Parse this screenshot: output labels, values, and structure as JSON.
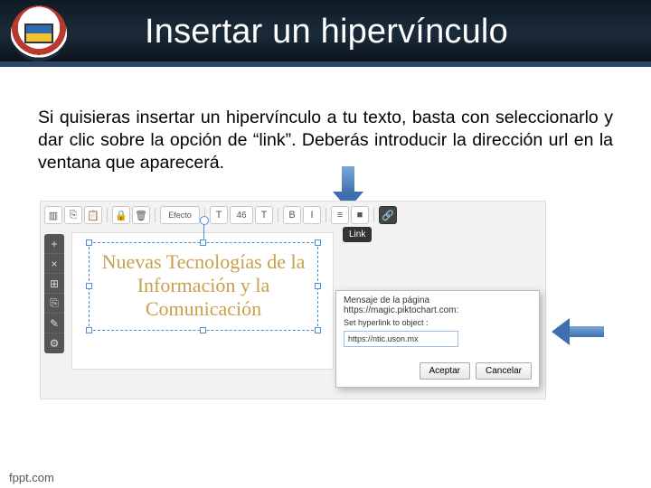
{
  "header": {
    "title": "Insertar un hipervínculo"
  },
  "body": {
    "paragraph": "Si quisieras insertar un hipervínculo a tu texto, basta con seleccionarlo y dar clic sobre la opción de “link”. Deberás introducir la dirección url en la ventana que aparecerá."
  },
  "toolbar": {
    "items": [
      "content",
      "copy",
      "paste",
      "separator",
      "lock",
      "delete",
      "separator",
      "effects",
      "separator",
      "font-size",
      "font-dec",
      "font-inc",
      "separator",
      "bold",
      "italic",
      "separator",
      "align",
      "color",
      "separator",
      "link"
    ],
    "link_tooltip": "Link",
    "effects_label": "Efecto",
    "font_size_value": "46"
  },
  "sidetool": {
    "items": [
      "+",
      "×",
      "⊞",
      "⎘",
      "✎",
      "⚙"
    ]
  },
  "canvas": {
    "selected_text": "Nuevas Tecnologías de la Información y la Comunicación"
  },
  "dialog": {
    "title": "Mensaje de la página https://magic.piktochart.com:",
    "label": "Set hyperlink to object :",
    "input_value": "https://ntic.uson.mx",
    "accept": "Aceptar",
    "cancel": "Cancelar"
  },
  "footer": {
    "text": "fppt.com"
  },
  "icons": {
    "content": "▥",
    "copy": "⎘",
    "paste": "📋",
    "lock": "🔒",
    "delete": "🗑",
    "font_dec": "T",
    "font_inc": "T",
    "bold": "B",
    "italic": "I",
    "align": "≡",
    "color": "■",
    "link": "🔗"
  }
}
